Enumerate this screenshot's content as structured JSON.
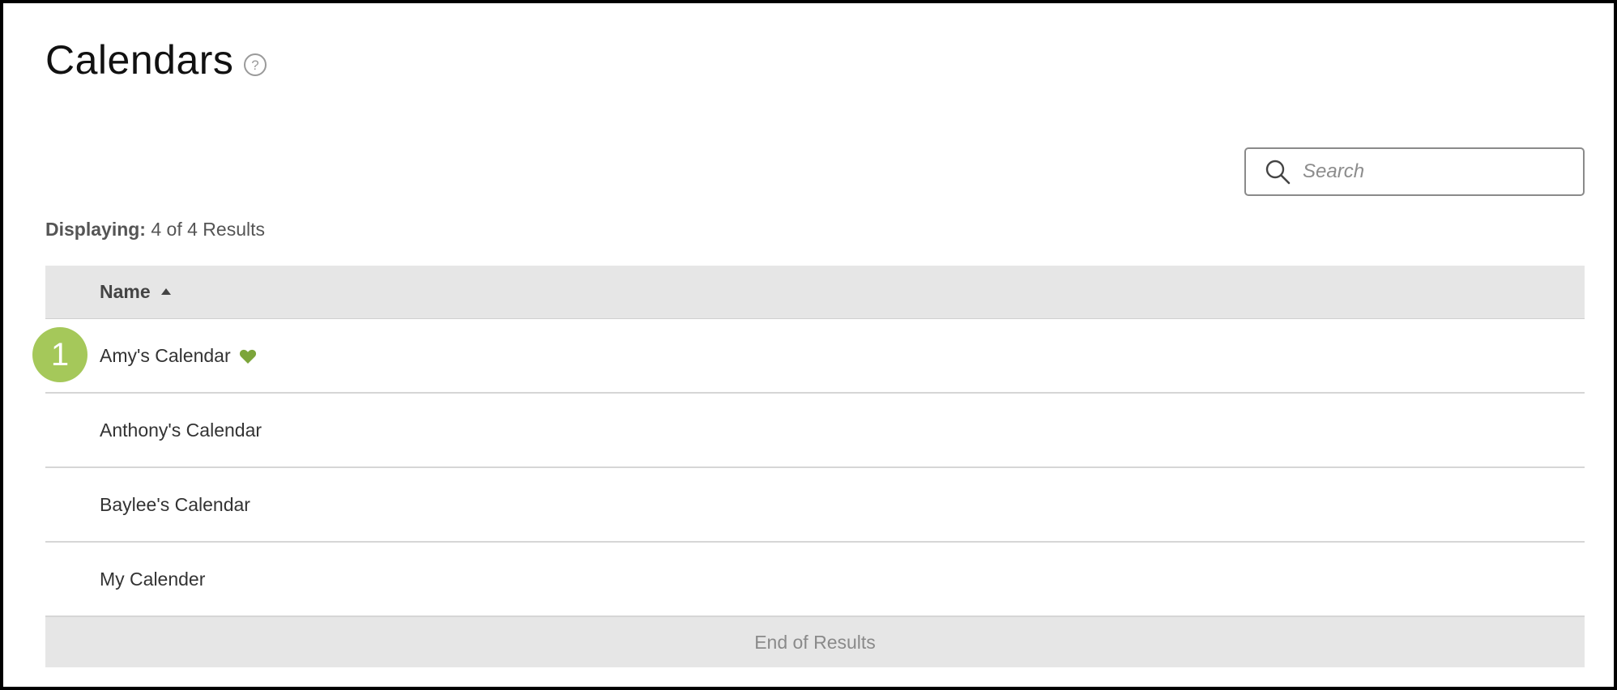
{
  "page": {
    "title": "Calendars",
    "help_icon": "question-circle-icon"
  },
  "search": {
    "placeholder": "Search",
    "value": "",
    "icon": "search-icon"
  },
  "results": {
    "label": "Displaying:",
    "text": "4 of 4 Results"
  },
  "table": {
    "column_header": "Name",
    "sort": "ascending",
    "rows": [
      {
        "name": "Amy's Calendar",
        "favorite": true
      },
      {
        "name": "Anthony's Calendar",
        "favorite": false
      },
      {
        "name": "Baylee's Calendar",
        "favorite": false
      },
      {
        "name": "My Calender",
        "favorite": false
      }
    ],
    "end_label": "End of Results"
  },
  "annotation": {
    "step_number": "1"
  },
  "colors": {
    "favorite_heart": "#7ca53a",
    "step_badge": "#a5c85a",
    "header_bg": "#e6e6e6"
  }
}
